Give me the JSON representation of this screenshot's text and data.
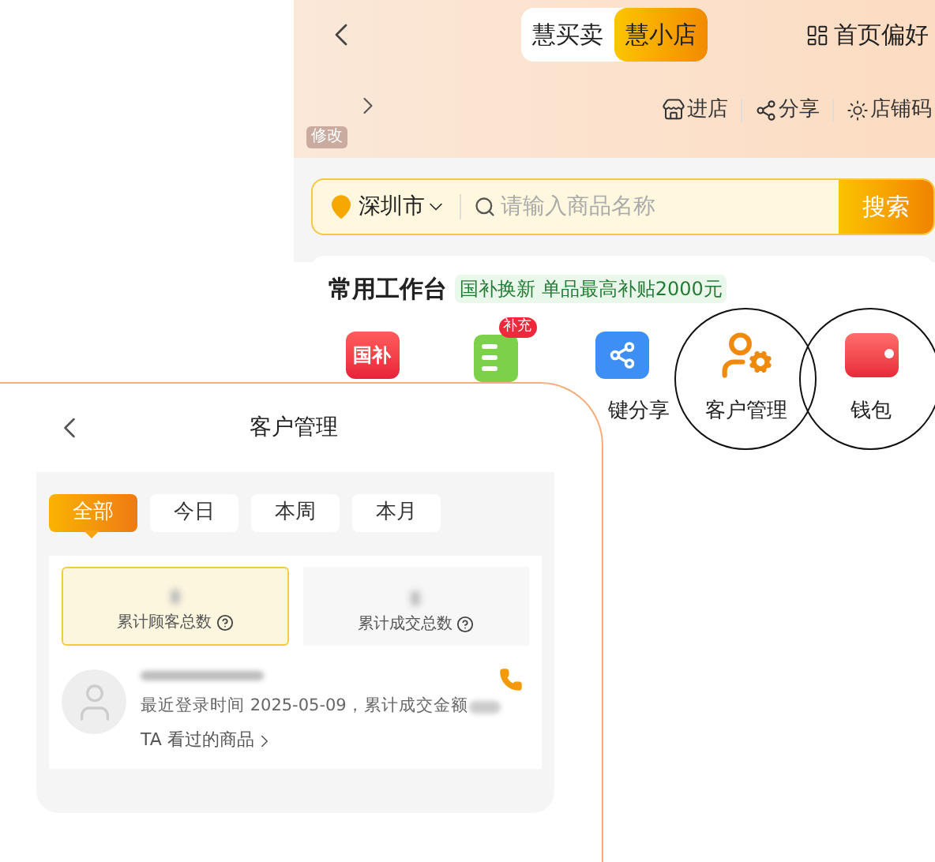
{
  "header": {
    "toggle": [
      {
        "label": "慧买卖",
        "selected": false
      },
      {
        "label": "慧小店",
        "selected": true
      }
    ],
    "preference": "首页偏好"
  },
  "shop_bar": {
    "edit_tag": "修改",
    "actions": [
      {
        "kind": "store",
        "label": "进店"
      },
      {
        "kind": "share",
        "label": "分享"
      },
      {
        "kind": "qrcode",
        "label": "店铺码"
      }
    ]
  },
  "search": {
    "city": "深圳市",
    "placeholder": "请输入商品名称",
    "button": "搜索"
  },
  "workbench": {
    "title": "常用工作台",
    "promo": "国补换新 单品最高补贴2000元",
    "tools": [
      {
        "kind": "subsidy",
        "icon_text": "国补",
        "circled": false
      },
      {
        "kind": "list",
        "badge": "补充",
        "circled": false
      },
      {
        "kind": "share",
        "label": "键分享",
        "circled": false
      },
      {
        "kind": "customer",
        "label": "客户管理",
        "circled": true
      },
      {
        "kind": "wallet",
        "label": "钱包",
        "circled": true
      }
    ]
  },
  "customer_panel": {
    "title": "客户管理",
    "tabs": [
      {
        "label": "全部",
        "selected": true
      },
      {
        "label": "今日",
        "selected": false
      },
      {
        "label": "本周",
        "selected": false
      },
      {
        "label": "本月",
        "selected": false
      }
    ],
    "stats": [
      {
        "label": "累计顾客总数",
        "selected": true
      },
      {
        "label": "累计成交总数",
        "selected": false
      }
    ],
    "customers": [
      {
        "login": "最近登录时间 2025-05-09，累计成交金额",
        "link": "TA 看过的商品"
      }
    ]
  }
}
